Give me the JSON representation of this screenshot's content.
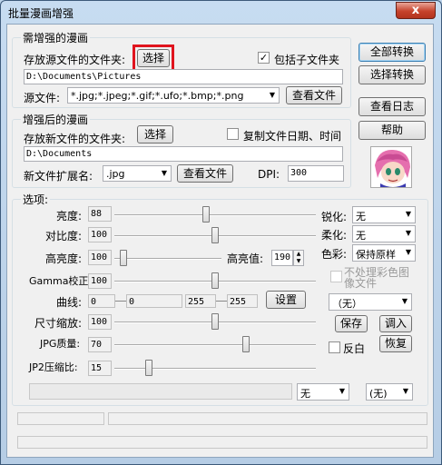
{
  "window": {
    "title": "批量漫画增强",
    "close": "x"
  },
  "source": {
    "group_label": "需增强的漫画",
    "folder_label": "存放源文件的文件夹:",
    "select_button": "选择",
    "include_subfolders": "包括子文件夹",
    "include_subfolders_checked": true,
    "path": "D:\\Documents\\Pictures",
    "files_label": "源文件:",
    "files_pattern": "*.jpg;*.jpeg;*.gif;*.ufo;*.bmp;*.png",
    "view_files_button": "查看文件"
  },
  "output": {
    "group_label": "增强后的漫画",
    "folder_label": "存放新文件的文件夹:",
    "select_button": "选择",
    "copy_dates": "复制文件日期、时间",
    "copy_dates_checked": false,
    "path": "D:\\Documents",
    "ext_label": "新文件扩展名:",
    "ext_value": ".jpg",
    "view_files_button": "查看文件",
    "dpi_label": "DPI:",
    "dpi_value": "300"
  },
  "side_buttons": {
    "convert_all": "全部转换",
    "convert_selected": "选择转换",
    "view_log": "查看日志",
    "help": "帮助"
  },
  "options": {
    "group_label": "选项:",
    "brightness": {
      "label": "亮度:",
      "value": "88"
    },
    "contrast": {
      "label": "对比度:",
      "value": "100"
    },
    "high_brightness": {
      "label": "高亮度:",
      "value": "100"
    },
    "highlight_value": {
      "label": "高亮值:",
      "value": "190"
    },
    "gamma": {
      "label": "Gamma校正:",
      "value": "100"
    },
    "curve": {
      "label": "曲线:",
      "v1": "0",
      "v2": "0",
      "v3": "255",
      "v4": "255",
      "button": "设置"
    },
    "scale": {
      "label": "尺寸缩放:",
      "value": "100"
    },
    "jpg_quality": {
      "label": "JPG质量:",
      "value": "70"
    },
    "jp2_ratio": {
      "label": "JP2压缩比:",
      "value": "15"
    },
    "sharpen": {
      "label": "锐化:",
      "value": "无"
    },
    "soften": {
      "label": "柔化:",
      "value": "无"
    },
    "color": {
      "label": "色彩:",
      "value": "保持原样"
    },
    "skip_color": "不处理彩色图像文件",
    "preset": "（无）",
    "save_button": "保存",
    "load_button": "调入",
    "invert": "反白",
    "restore_button": "恢复",
    "bottom_combo1": "无",
    "bottom_combo2": "(无)"
  },
  "colors": {
    "highlight": "#e0141e",
    "close": "#c6432c"
  }
}
